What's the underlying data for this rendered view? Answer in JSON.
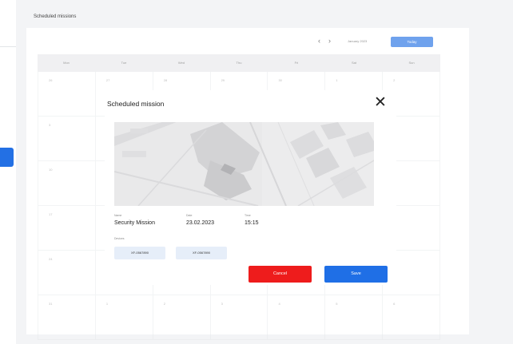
{
  "page": {
    "title": "Scheduled missions"
  },
  "calendar": {
    "prev_icon": "‹",
    "next_icon": "›",
    "month_label": "January 2023",
    "today_label": "Today",
    "weekdays": [
      "Mon",
      "Tue",
      "Wed",
      "Thu",
      "Fri",
      "Sat",
      "Sun"
    ],
    "weeks": [
      [
        "26",
        "27",
        "28",
        "29",
        "30",
        "1",
        "2"
      ],
      [
        "3",
        "",
        "",
        "",
        "",
        "",
        ""
      ],
      [
        "10",
        "",
        "",
        "",
        "",
        "",
        ""
      ],
      [
        "17",
        "",
        "",
        "",
        "",
        "",
        ""
      ],
      [
        "24",
        "",
        "",
        "",
        "",
        "",
        ""
      ],
      [
        "31",
        "1",
        "2",
        "3",
        "4",
        "5",
        "6"
      ]
    ]
  },
  "modal": {
    "title": "Scheduled mission",
    "close_icon": "✕",
    "name_label": "Name",
    "name_value": "Security Mission",
    "date_label": "Date",
    "date_value": "23.02.2023",
    "time_label": "Time",
    "time_value": "15:15",
    "devices_label": "Devices",
    "devices": [
      "XF-0567890",
      "XF-0567890"
    ],
    "cancel_label": "Cancel",
    "save_label": "Save"
  },
  "colors": {
    "accent": "#2370e4",
    "danger": "#ee1c1c"
  }
}
